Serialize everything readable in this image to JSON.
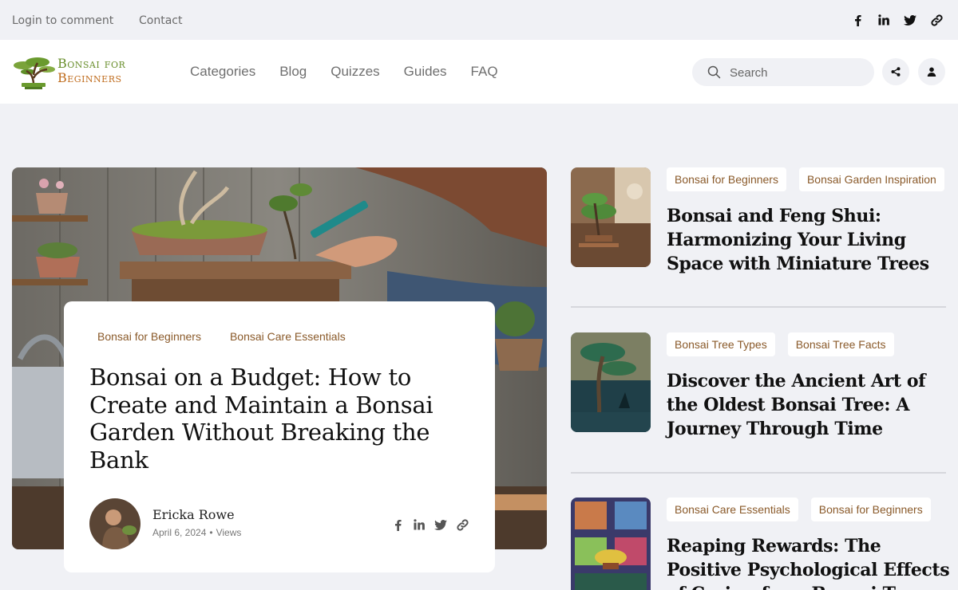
{
  "topbar": {
    "login_label": "Login to comment",
    "contact_label": "Contact",
    "social": [
      "facebook-icon",
      "linkedin-icon",
      "twitter-icon",
      "link-icon"
    ]
  },
  "header": {
    "logo_line1": "Bonsai for",
    "logo_line2": "Beginners",
    "nav": [
      "Categories",
      "Blog",
      "Quizzes",
      "Guides",
      "FAQ"
    ],
    "search_placeholder": "Search"
  },
  "featured": {
    "tags": [
      "Bonsai for Beginners",
      "Bonsai Care Essentials"
    ],
    "title": "Bonsai on a Budget: How to Create and Maintain a Bonsai Garden Without Breaking the Bank",
    "author": "Ericka Rowe",
    "date": "April 6, 2024",
    "views_label": "Views"
  },
  "articles": [
    {
      "tags": [
        "Bonsai for Beginners",
        "Bonsai Garden Inspiration"
      ],
      "title": "Bonsai and Feng Shui: Harmonizing Your Living Space with Miniature Trees"
    },
    {
      "tags": [
        "Bonsai Tree Types",
        "Bonsai Tree Facts"
      ],
      "title": "Discover the Ancient Art of the Oldest Bonsai Tree: A Journey Through Time"
    },
    {
      "tags": [
        "Bonsai Care Essentials",
        "Bonsai for Beginners"
      ],
      "title": "Reaping Rewards: The Positive Psychological Effects of Caring for a Bonsai Tree"
    }
  ],
  "colors": {
    "page_bg": "#f0f1f5",
    "tag_text": "#8a5a2a",
    "logo_green": "#6a8f2d",
    "logo_orange": "#c06d1f"
  }
}
